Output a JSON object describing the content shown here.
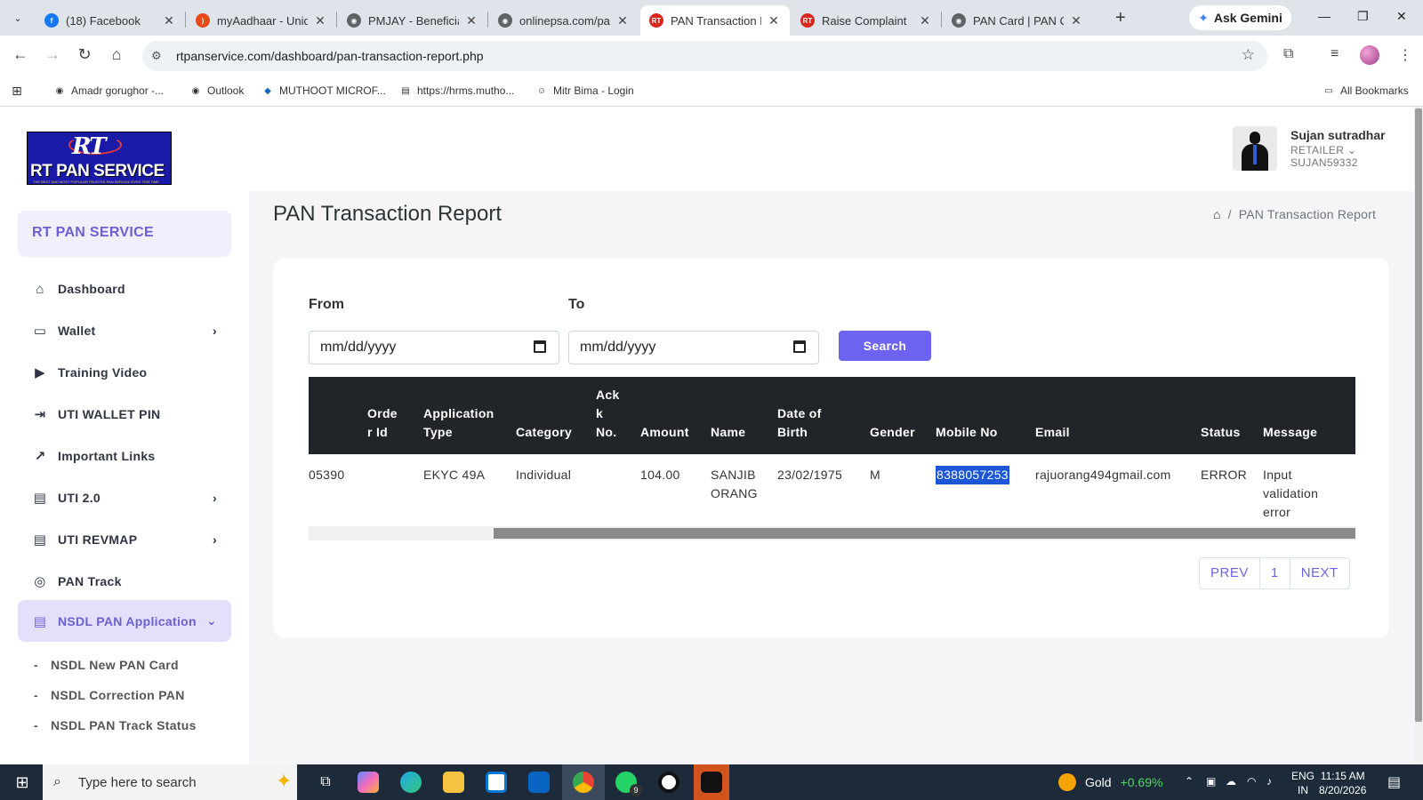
{
  "browser": {
    "tabs": [
      {
        "label": "(18) Facebook",
        "color": "#1877f2",
        "glyph": "f"
      },
      {
        "label": "myAadhaar - Uniqu",
        "color": "#e64a19",
        "glyph": ")"
      },
      {
        "label": "PMJAY - Beneficiary",
        "color": "#5f6368",
        "glyph": "◉"
      },
      {
        "label": "onlinepsa.com/pay",
        "color": "#5f6368",
        "glyph": "◉"
      },
      {
        "label": "PAN Transaction Re",
        "color": "#d9261c",
        "glyph": "RT"
      },
      {
        "label": "Raise Complaint",
        "color": "#d9261c",
        "glyph": "RT"
      },
      {
        "label": "PAN Card | PAN Ca",
        "color": "#5f6368",
        "glyph": "◉"
      }
    ],
    "active_tab_index": 4,
    "gemini_label": "Ask Gemini",
    "url": "rtpanservice.com/dashboard/pan-transaction-report.php",
    "bookmarks": [
      "Amadr gorughor -...",
      "Outlook",
      "MUTHOOT MICROF...",
      "https://hrms.mutho...",
      "Mitr Bima - Login"
    ],
    "all_bookmarks": "All Bookmarks"
  },
  "sidebar": {
    "logo_monogram": "RT",
    "logo_name": "RT PAN SERVICE",
    "logo_tagline": "THE BEST AND MOST POPULAR TRUSTED PAN SERVICE EVER THIS TIME",
    "brand": "RT PAN SERVICE",
    "items": [
      {
        "label": "Dashboard",
        "icon": "home-icon",
        "has_chevron": false
      },
      {
        "label": "Wallet",
        "icon": "wallet-icon",
        "has_chevron": true
      },
      {
        "label": "Training Video",
        "icon": "video-icon",
        "has_chevron": false
      },
      {
        "label": "UTI WALLET PIN",
        "icon": "login-icon",
        "has_chevron": false
      },
      {
        "label": "Important Links",
        "icon": "external-link-icon",
        "has_chevron": false
      },
      {
        "label": "UTI 2.0",
        "icon": "document-icon",
        "has_chevron": true
      },
      {
        "label": "UTI REVMAP",
        "icon": "document-icon",
        "has_chevron": true
      },
      {
        "label": "PAN Track",
        "icon": "compass-icon",
        "has_chevron": false
      },
      {
        "label": "NSDL PAN Application",
        "icon": "document-icon",
        "has_chevron": true
      }
    ],
    "active_item": "NSDL PAN Application",
    "sub_items": [
      "NSDL New PAN Card",
      "NSDL Correction PAN",
      "NSDL PAN Track Status"
    ]
  },
  "header": {
    "user_name": "Sujan sutradhar",
    "user_role": "RETAILER",
    "user_id": "SUJAN59332"
  },
  "main": {
    "title": "PAN Transaction Report",
    "breadcrumb_current": "PAN Transaction Report",
    "filter": {
      "from_label": "From",
      "to_label": "To",
      "from_placeholder": "mm/dd/yyyy",
      "to_placeholder": "mm/dd/yyyy",
      "search_label": "Search"
    },
    "table": {
      "columns": [
        "Orde r Id",
        "Application Type",
        "Category",
        "Ack k No.",
        "Amount",
        "Name",
        "Date of Birth",
        "Gender",
        "Mobile No",
        "Email",
        "Status",
        "Message"
      ],
      "rows": [
        {
          "order_id": "05390",
          "application_type": "EKYC 49A",
          "category": "Individual",
          "ack_no": "",
          "amount": "104.00",
          "name": "SANJIB ORANG",
          "dob": "23/02/1975",
          "gender": "M",
          "mobile": "8388057253",
          "email": "rajuorang494gmail.com",
          "status": "ERROR",
          "message": "Input validation error"
        }
      ]
    },
    "pagination": {
      "prev": "PREV",
      "page": "1",
      "next": "NEXT"
    }
  },
  "taskbar": {
    "search_placeholder": "Type here to search",
    "gold_label": "Gold",
    "gold_change": "+0.69%",
    "lang": "ENG",
    "region": "IN",
    "time": "11:15 AM",
    "date": "8/20/2026",
    "whatsapp_badge": "9"
  },
  "colors": {
    "accent": "#6c63f0",
    "table_header": "#212529",
    "active_menu_bg": "#e4e0fb"
  }
}
